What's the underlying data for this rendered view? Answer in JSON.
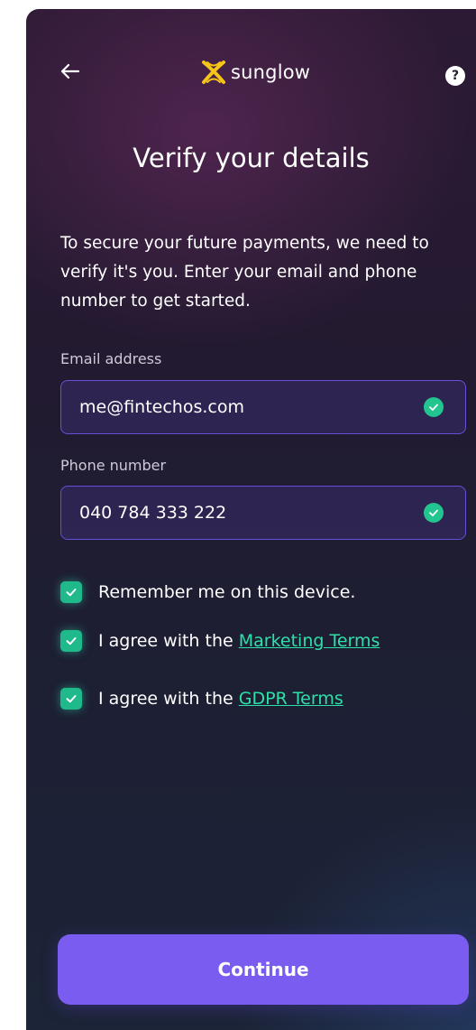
{
  "header": {
    "brand": "sunglow",
    "help_label": "?"
  },
  "title": "Verify your details",
  "intro": "To secure your future payments, we need to verify it's you. Enter your email and phone number to get started.",
  "form": {
    "email": {
      "label": "Email address",
      "value": "me@fintechos.com"
    },
    "phone": {
      "label": "Phone number",
      "value": "040 784 333 222"
    }
  },
  "checks": {
    "remember": {
      "label": "Remember me on this device.",
      "checked": true
    },
    "marketing": {
      "prefix": "I agree with the ",
      "link": "Marketing Terms",
      "checked": true
    },
    "gdpr": {
      "prefix": "I agree with the ",
      "link": "GDPR Terms",
      "checked": true
    }
  },
  "continue_label": "Continue",
  "colors": {
    "accent": "#7b5cf0",
    "success": "#22c48f",
    "link": "#2ee0a8",
    "logo": "#f5c518"
  }
}
